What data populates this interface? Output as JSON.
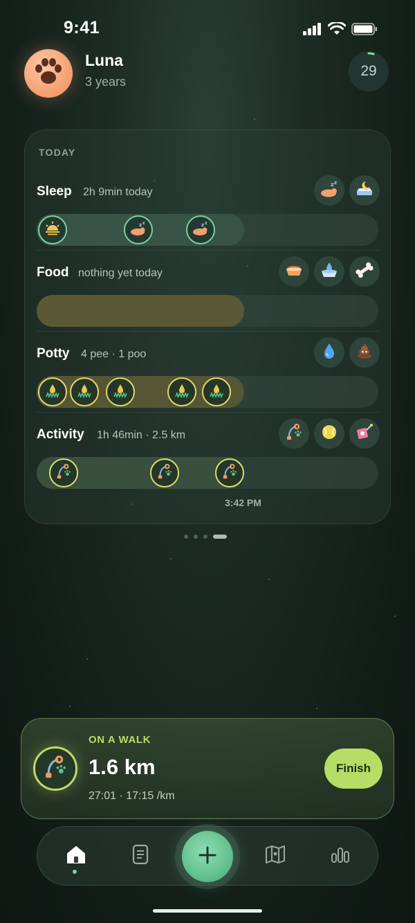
{
  "status_bar": {
    "time": "9:41"
  },
  "profile": {
    "name": "Luna",
    "age": "3 years",
    "score": "29"
  },
  "today": {
    "label": "TODAY",
    "sleep": {
      "title": "Sleep",
      "summary": "2h 9min today"
    },
    "food": {
      "title": "Food",
      "summary": "nothing yet today"
    },
    "potty": {
      "title": "Potty",
      "summary": "4 pee · 1 poo"
    },
    "activity": {
      "title": "Activity",
      "summary": "1h 46min · 2.5 km"
    },
    "current_time": "3:42 PM"
  },
  "pager": {
    "pages": 4,
    "active_index": 3
  },
  "walk": {
    "label": "ON A WALK",
    "distance": "1.6 km",
    "meta": "27:01 · 17:15 /km",
    "finish_label": "Finish"
  },
  "tabs": [
    "home-icon",
    "log-icon",
    "add-icon",
    "map-icon",
    "stats-icon"
  ],
  "colors": {
    "accent_green": "#b7dd66",
    "sleep_ring": "#7fcf9d",
    "food_fill": "#5b5935",
    "potty_ring": "#e8d66a",
    "avatar_orange": "#f6a275",
    "add_button": "#5fbf8c"
  }
}
